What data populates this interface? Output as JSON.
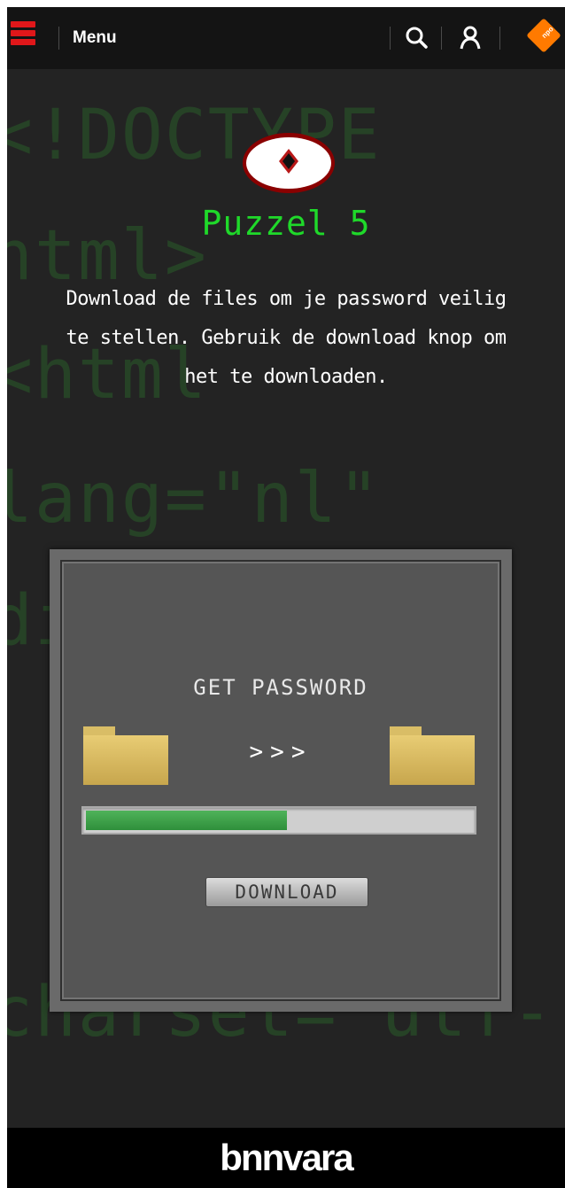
{
  "header": {
    "menu_label": "Menu",
    "icons": [
      "hamburger-logo-icon",
      "search-icon",
      "user-icon",
      "npo-logo-icon"
    ],
    "npo_text": "npo",
    "brand_color": "#e0171a",
    "npo_color": "#ff7a00"
  },
  "background_code": [
    "<!DOCTYPE",
    "html>",
    "<html",
    "lang=\"nl\"",
    "di",
    "charset=\"utf-"
  ],
  "puzzle": {
    "title": "Puzzel 5",
    "title_color": "#1fd92a",
    "intro": "Download de files om je password veilig te stellen. Gebruik de download knop om het te downloaden."
  },
  "panel": {
    "heading": "GET PASSWORD",
    "arrows": ">>>",
    "progress_fraction": 0.52,
    "progress_color": "#3aa046",
    "download_label": "DOWNLOAD"
  },
  "footer": {
    "brand": "bnnvara"
  }
}
